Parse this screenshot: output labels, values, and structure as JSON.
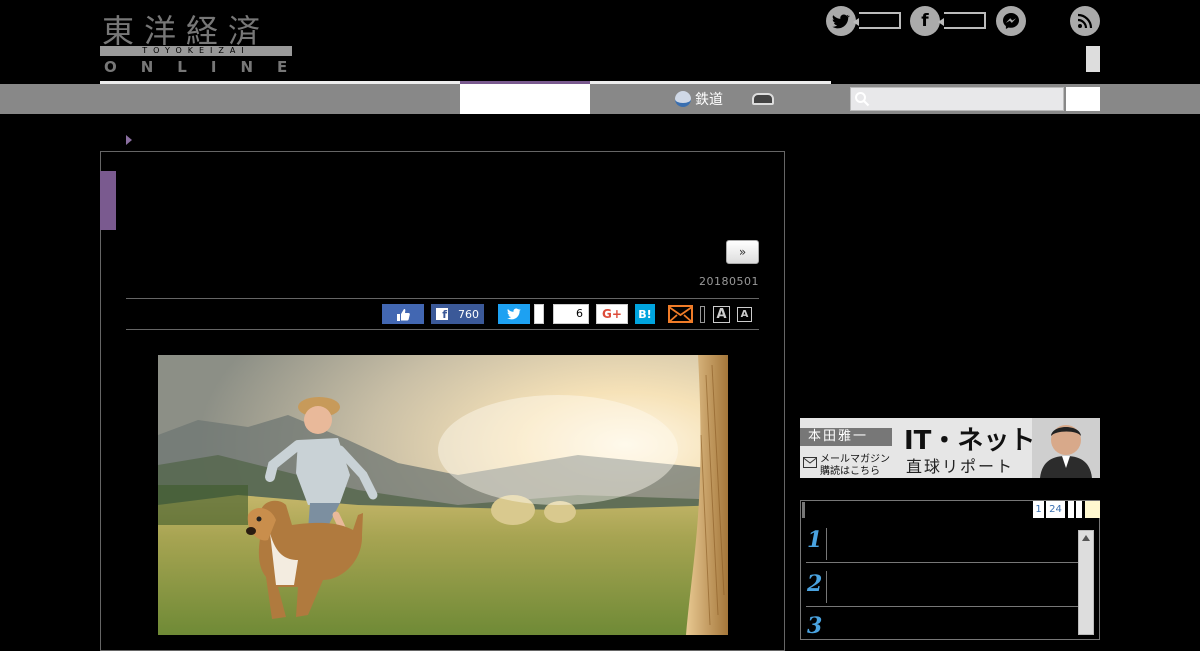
{
  "header": {
    "logo_kanji": "東洋経済",
    "logo_band": "TOYOKEIZAI",
    "logo_online": "ONLINE"
  },
  "nav": {
    "items": [
      {
        "label": "鉄道",
        "icon": "train-icon"
      },
      {
        "label": "",
        "icon": "car-icon"
      }
    ]
  },
  "search": {
    "placeholder": ""
  },
  "article": {
    "next_label": "»",
    "date": "20180501",
    "share": {
      "facebook_count": "760",
      "pocket_count": "6"
    }
  },
  "sidebar": {
    "banner": {
      "author": "本田雅一",
      "title": "IT・ネット",
      "subtitle": "直球リポート",
      "mail_line1": "メールマガジン",
      "mail_line2": "購読はこちら"
    },
    "ranking": {
      "pages": [
        "1",
        "24"
      ],
      "ranks": [
        "1",
        "2",
        "3"
      ]
    }
  },
  "colors": {
    "accent": "#7a5a8f",
    "facebook": "#3b5998",
    "twitter": "#1da1f2",
    "hatena": "#00a4de"
  }
}
